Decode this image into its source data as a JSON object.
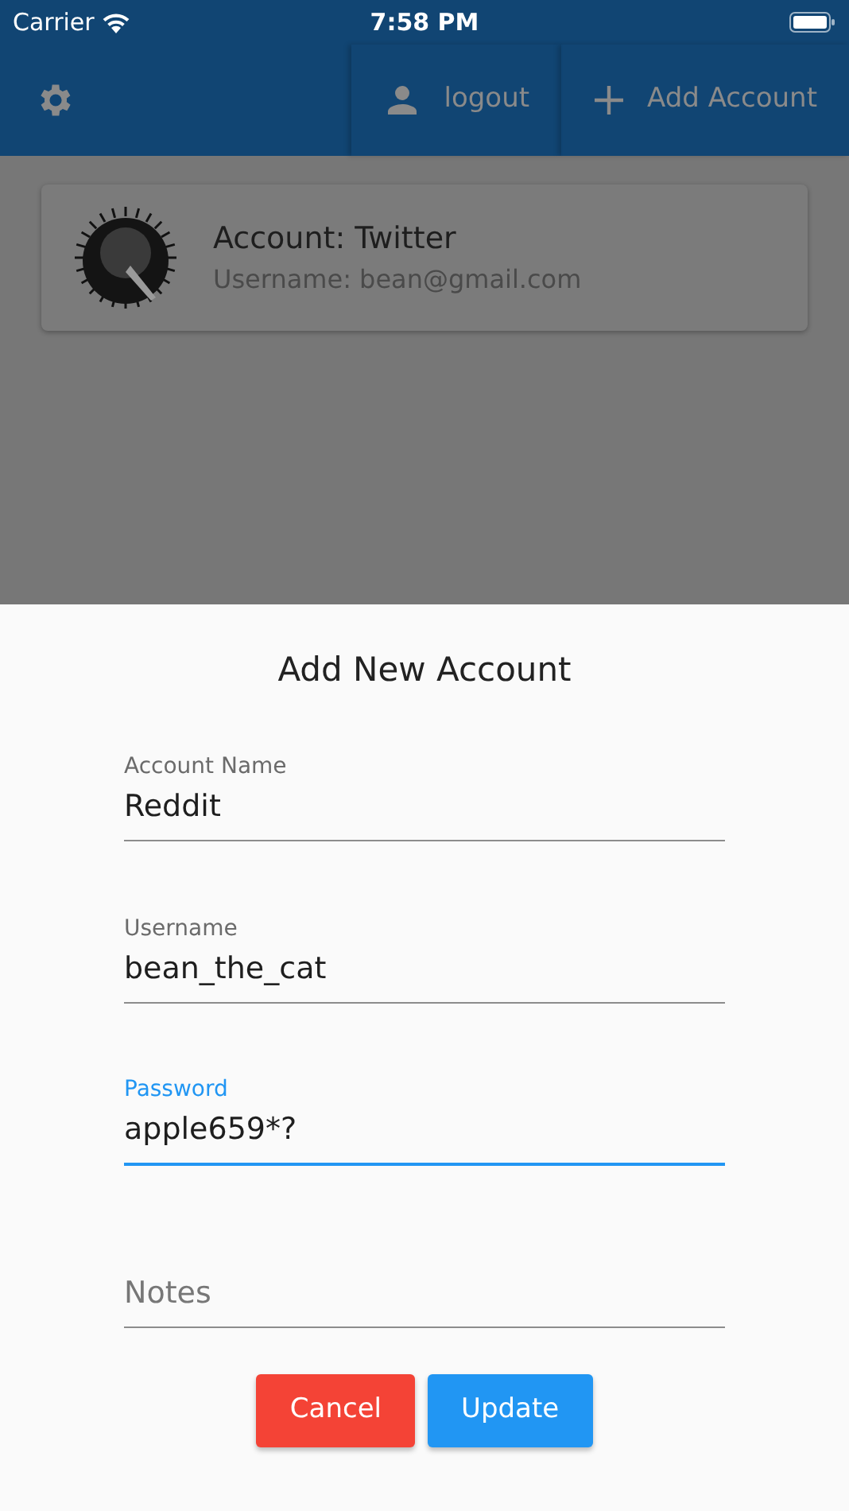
{
  "status_bar": {
    "carrier": "Carrier",
    "time": "7:58 PM"
  },
  "app_bar": {
    "actions": [
      {
        "kind": "settings"
      },
      {
        "kind": "logout",
        "label": "logout"
      },
      {
        "kind": "add",
        "label": "Add Account"
      }
    ]
  },
  "accounts": [
    {
      "title": "Account: Twitter",
      "subtitle": "Username: bean@gmail.com"
    }
  ],
  "sheet": {
    "title": "Add New Account",
    "fields": [
      {
        "label": "Account Name",
        "value": "Reddit",
        "focused": false
      },
      {
        "label": "Username",
        "value": "bean_the_cat",
        "focused": false
      },
      {
        "label": "Password",
        "value": "apple659*?",
        "focused": true
      },
      {
        "placeholder": "Notes",
        "focused": false
      }
    ],
    "buttons": [
      {
        "kind": "cancel",
        "label": "Cancel"
      },
      {
        "kind": "primary",
        "label": "Update"
      }
    ]
  }
}
